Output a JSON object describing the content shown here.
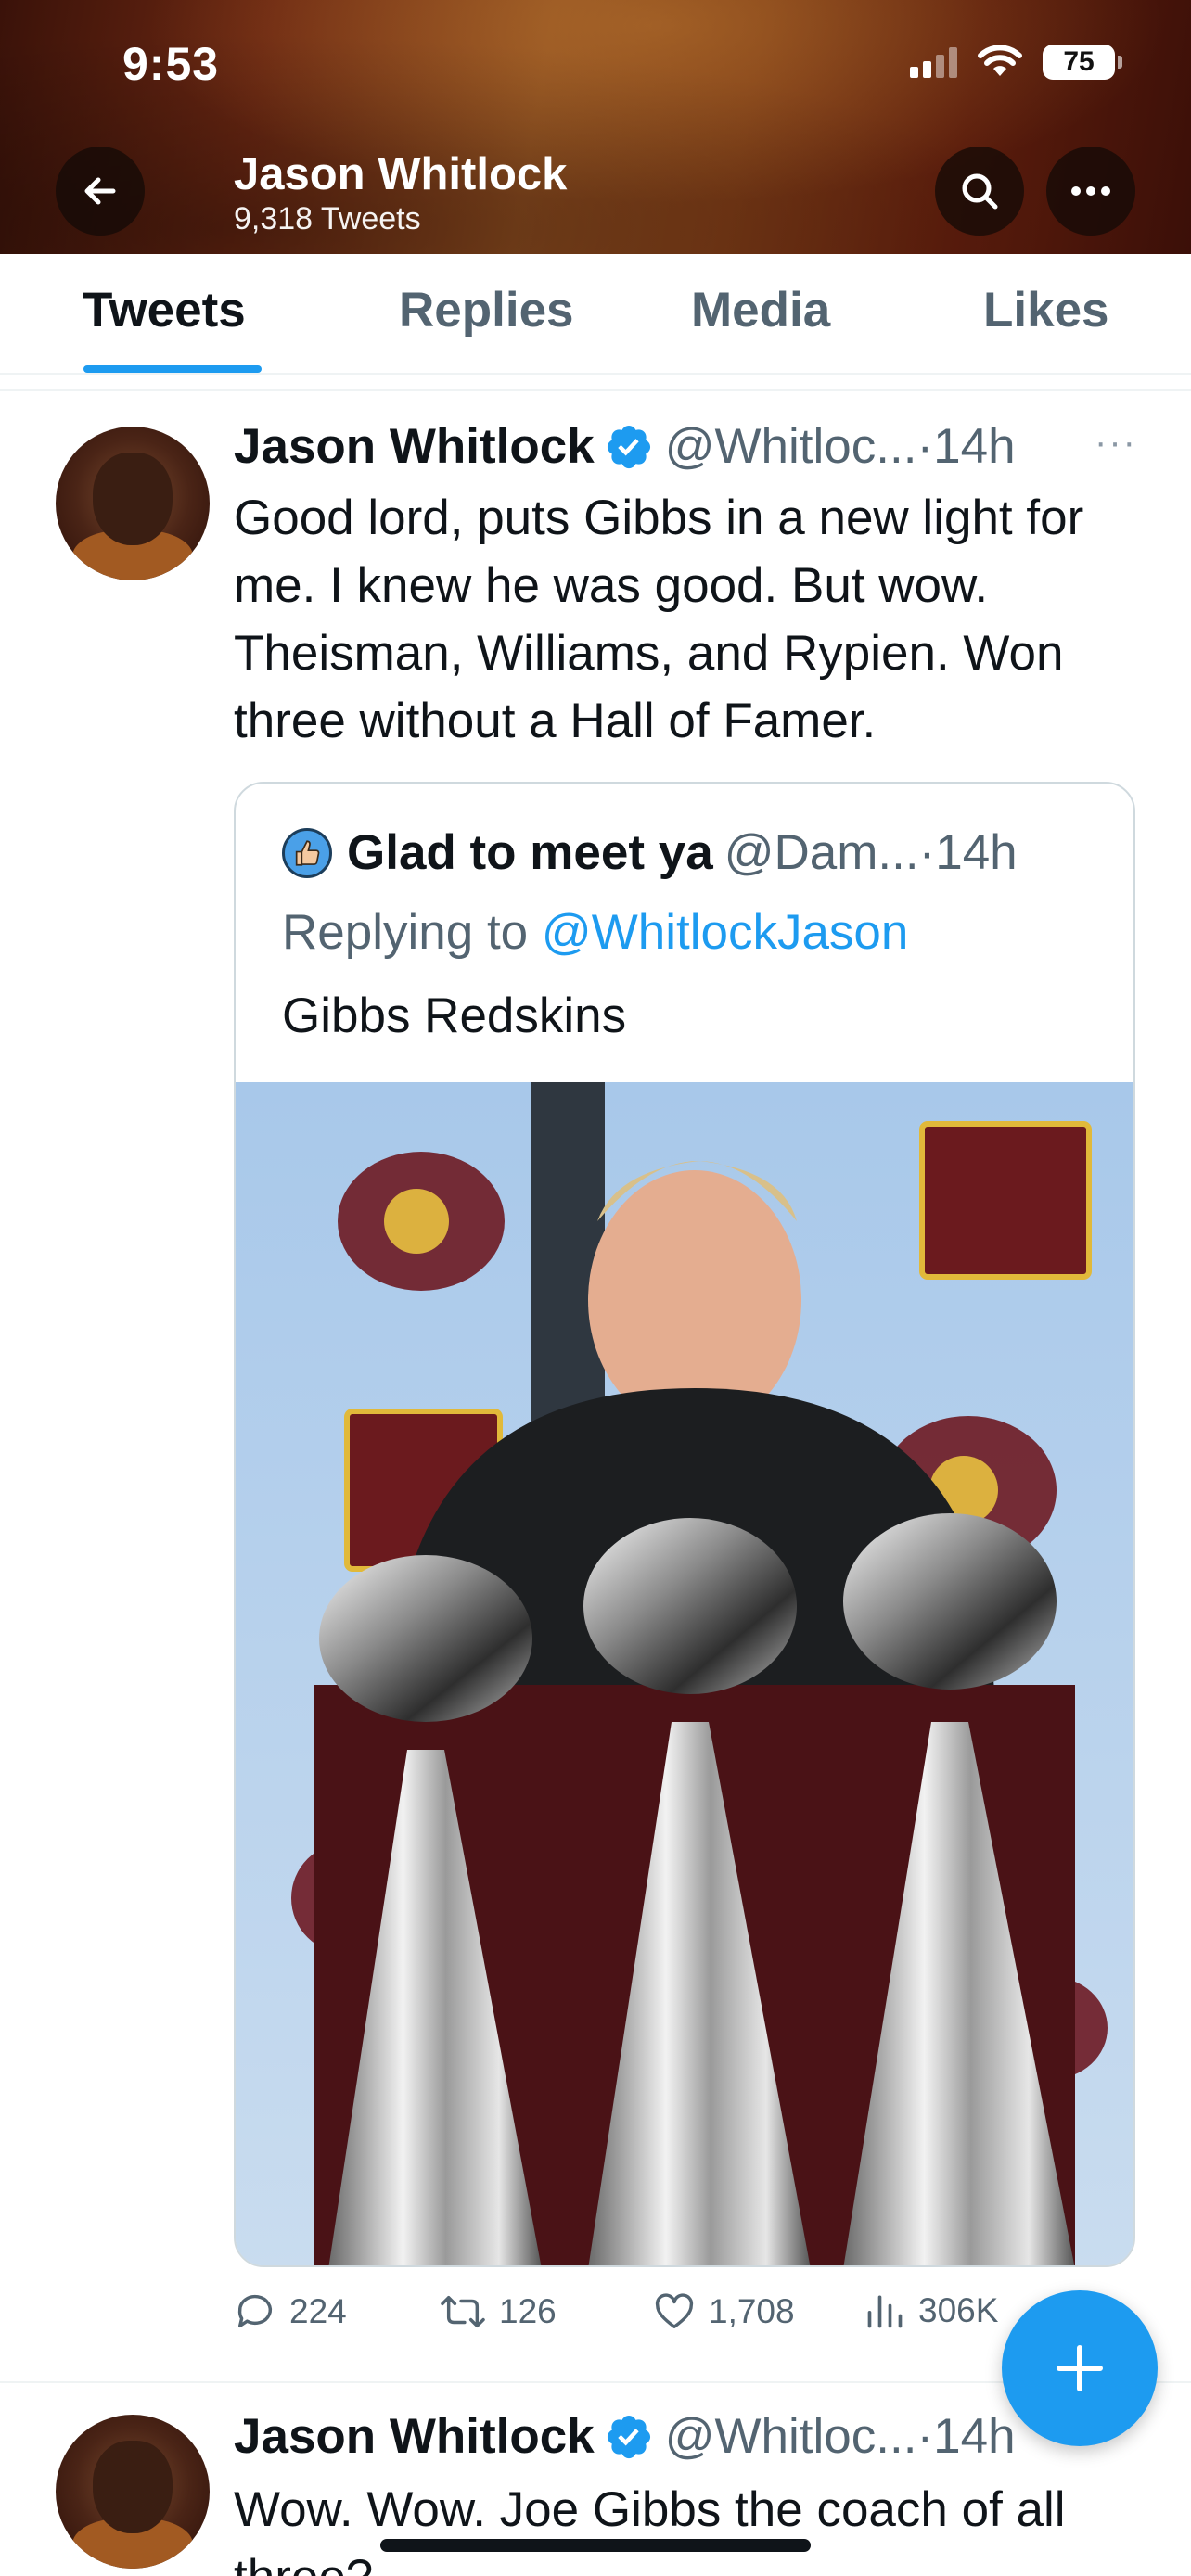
{
  "status_bar": {
    "time": "9:53",
    "battery": "75"
  },
  "header": {
    "name": "Jason Whitlock",
    "tweet_count": "9,318 Tweets"
  },
  "tabs": [
    {
      "label": "Tweets",
      "active": true
    },
    {
      "label": "Replies",
      "active": false
    },
    {
      "label": "Media",
      "active": false
    },
    {
      "label": "Likes",
      "active": false
    }
  ],
  "tweets": [
    {
      "name": "Jason Whitlock",
      "handle": "@Whitloc...",
      "dot": "·",
      "time": "14h",
      "more": "···",
      "text": "Good lord, puts Gibbs in a new light for me. I knew he was good. But wow. Theisman, Williams, and Rypien. Won three without a Hall of Famer.",
      "quote": {
        "name": "Glad to meet ya",
        "handle": "@Dam...",
        "dot": "·",
        "time": "14h",
        "reply_prefix": "Replying to",
        "reply_mention": "@WhitlockJason",
        "text": "Gibbs Redskins"
      },
      "stats": {
        "replies": "224",
        "retweets": "126",
        "likes": "1,708",
        "views": "306K"
      }
    },
    {
      "name": "Jason Whitlock",
      "handle": "@Whitloc...",
      "dot": "·",
      "time": "14h",
      "text": "Wow. Wow. Joe Gibbs the coach of all three?"
    }
  ],
  "fab": {
    "icon": "plus-icon"
  },
  "colors": {
    "accent": "#1d9bf0",
    "text": "#0f1419",
    "muted": "#536471"
  }
}
